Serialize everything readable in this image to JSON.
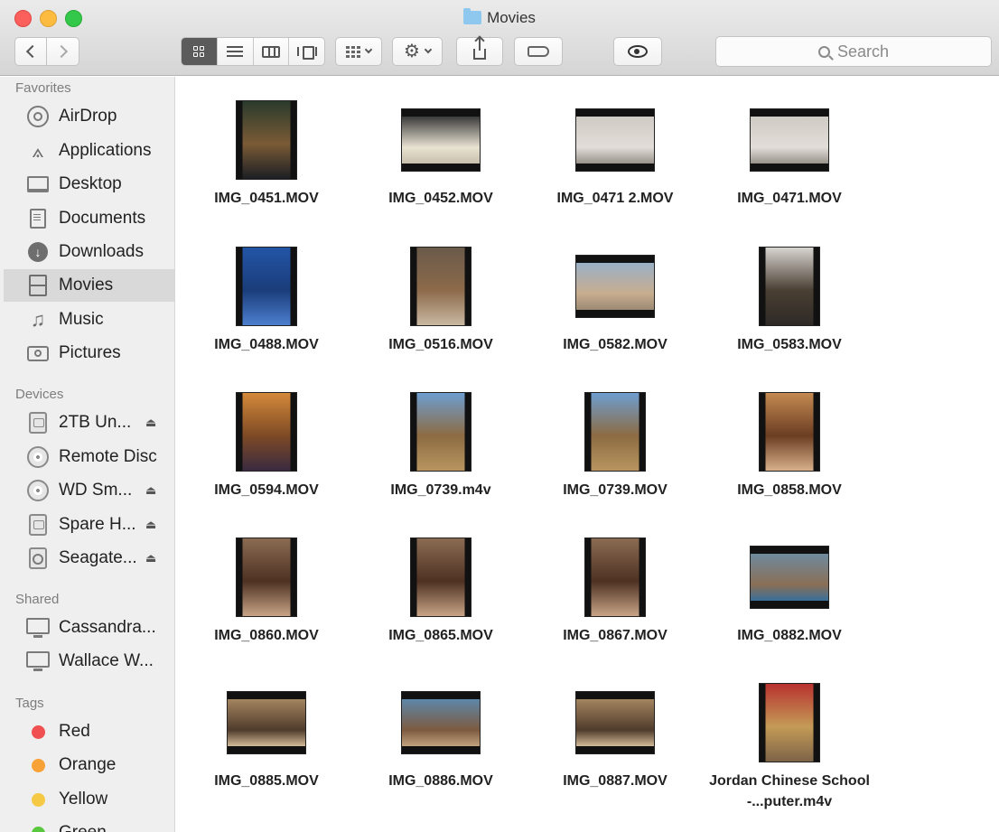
{
  "window": {
    "title": "Movies"
  },
  "toolbar": {
    "search_placeholder": "Search"
  },
  "sidebar": {
    "favorites_label": "Favorites",
    "favorites": [
      {
        "label": "AirDrop",
        "icon": "airdrop-icon"
      },
      {
        "label": "Applications",
        "icon": "applications-icon"
      },
      {
        "label": "Desktop",
        "icon": "desktop-icon"
      },
      {
        "label": "Documents",
        "icon": "documents-icon"
      },
      {
        "label": "Downloads",
        "icon": "downloads-icon"
      },
      {
        "label": "Movies",
        "icon": "movies-icon",
        "selected": true
      },
      {
        "label": "Music",
        "icon": "music-icon"
      },
      {
        "label": "Pictures",
        "icon": "pictures-icon"
      }
    ],
    "devices_label": "Devices",
    "devices": [
      {
        "label": "2TB Un...",
        "icon": "drive-icon",
        "eject": true
      },
      {
        "label": "Remote Disc",
        "icon": "disc-icon",
        "eject": false
      },
      {
        "label": "WD Sm...",
        "icon": "disc-icon",
        "eject": true
      },
      {
        "label": "Spare H...",
        "icon": "drive-icon",
        "eject": true
      },
      {
        "label": "Seagate...",
        "icon": "time-machine-icon",
        "eject": true
      }
    ],
    "shared_label": "Shared",
    "shared": [
      {
        "label": "Cassandra...",
        "icon": "computer-icon"
      },
      {
        "label": "Wallace W...",
        "icon": "computer-icon"
      }
    ],
    "tags_label": "Tags",
    "tags": [
      {
        "label": "Red",
        "color": "#f0504f"
      },
      {
        "label": "Orange",
        "color": "#f7a136"
      },
      {
        "label": "Yellow",
        "color": "#f6c944"
      },
      {
        "label": "Green",
        "color": "#5ac83e"
      }
    ]
  },
  "files": [
    {
      "name": "IMG_0451.MOV",
      "orientation": "portrait",
      "colors": [
        "#2a3a2c",
        "#7b5b36",
        "#1b1e24"
      ]
    },
    {
      "name": "IMG_0452.MOV",
      "orientation": "landscape",
      "colors": [
        "#3b3b3b",
        "#e8e2d2",
        "#c9c0ad"
      ]
    },
    {
      "name": "IMG_0471 2.MOV",
      "orientation": "landscape",
      "colors": [
        "#cfcac4",
        "#e2ddd8",
        "#9a938c"
      ]
    },
    {
      "name": "IMG_0471.MOV",
      "orientation": "landscape",
      "colors": [
        "#cfcac4",
        "#e2ddd8",
        "#9a938c"
      ]
    },
    {
      "name": "IMG_0488.MOV",
      "orientation": "portrait",
      "colors": [
        "#2355a6",
        "#1a3d7a",
        "#4d7fcf"
      ]
    },
    {
      "name": "IMG_0516.MOV",
      "orientation": "portrait",
      "colors": [
        "#6a5a4a",
        "#8c6a4a",
        "#c9b8a2"
      ]
    },
    {
      "name": "IMG_0582.MOV",
      "orientation": "landscape",
      "colors": [
        "#9ab0c6",
        "#c7ad8f",
        "#9c8a73"
      ]
    },
    {
      "name": "IMG_0583.MOV",
      "orientation": "portrait",
      "colors": [
        "#d7d4d0",
        "#4a3f33",
        "#2e2a26"
      ]
    },
    {
      "name": "IMG_0594.MOV",
      "orientation": "portrait",
      "colors": [
        "#d4893a",
        "#7e4a25",
        "#3a2a40"
      ]
    },
    {
      "name": "IMG_0739.m4v",
      "orientation": "portrait",
      "colors": [
        "#6d9ecf",
        "#8d6b43",
        "#b8955f"
      ]
    },
    {
      "name": "IMG_0739.MOV",
      "orientation": "portrait",
      "colors": [
        "#6d9ecf",
        "#8d6b43",
        "#b8955f"
      ]
    },
    {
      "name": "IMG_0858.MOV",
      "orientation": "portrait",
      "colors": [
        "#c58a52",
        "#6b3d22",
        "#d8b08a"
      ]
    },
    {
      "name": "IMG_0860.MOV",
      "orientation": "portrait",
      "colors": [
        "#8b6b52",
        "#4d3122",
        "#c8a487"
      ]
    },
    {
      "name": "IMG_0865.MOV",
      "orientation": "portrait",
      "colors": [
        "#8b6b52",
        "#4d3122",
        "#c8a487"
      ]
    },
    {
      "name": "IMG_0867.MOV",
      "orientation": "portrait",
      "colors": [
        "#8b6b52",
        "#4d3122",
        "#c8a487"
      ]
    },
    {
      "name": "IMG_0882.MOV",
      "orientation": "landscape",
      "colors": [
        "#6e8a9e",
        "#8a6f55",
        "#3a6f9a"
      ]
    },
    {
      "name": "IMG_0885.MOV",
      "orientation": "landscape",
      "colors": [
        "#a3845f",
        "#4f3b2c",
        "#d2b996"
      ]
    },
    {
      "name": "IMG_0886.MOV",
      "orientation": "landscape",
      "colors": [
        "#5d87a8",
        "#7d5a3f",
        "#c0a27e"
      ]
    },
    {
      "name": "IMG_0887.MOV",
      "orientation": "landscape",
      "colors": [
        "#a3845f",
        "#4f3b2c",
        "#d2b996"
      ]
    },
    {
      "name": "Jordan Chinese School -...puter.m4v",
      "orientation": "portrait",
      "colors": [
        "#b8322f",
        "#c49a56",
        "#7d6448"
      ]
    }
  ]
}
